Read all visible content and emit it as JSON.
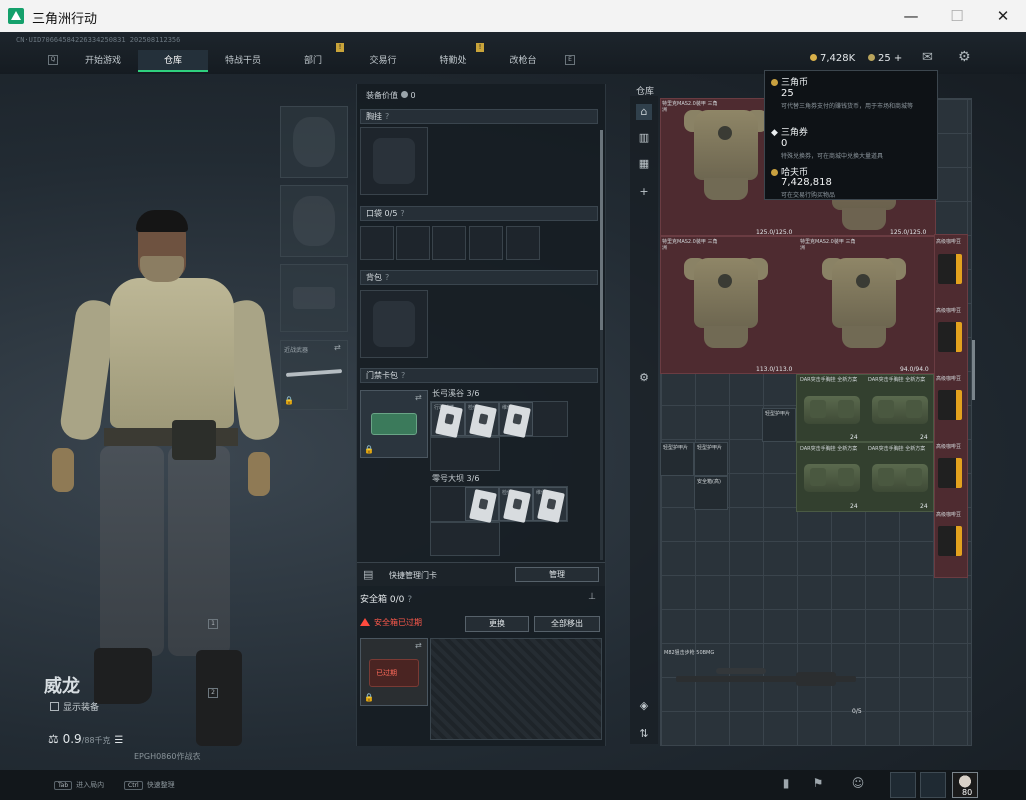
{
  "window": {
    "title": "三角洲行动",
    "minimize": "—",
    "maximize": "☐",
    "close": "✕"
  },
  "header": {
    "uid": "CN·UID70664584226334250831 202508112356",
    "key_left": "Q",
    "key_right": "E",
    "tabs": [
      {
        "label": "开始游戏",
        "active": false,
        "alert": false
      },
      {
        "label": "仓库",
        "active": true,
        "alert": false
      },
      {
        "label": "特战干员",
        "active": false,
        "alert": false
      },
      {
        "label": "部门",
        "active": false,
        "alert": true
      },
      {
        "label": "交易行",
        "active": false,
        "alert": false
      },
      {
        "label": "特勤处",
        "active": false,
        "alert": true
      },
      {
        "label": "改枪台",
        "active": false,
        "alert": false
      }
    ],
    "alert_mark": "!",
    "hafu_coin": "7,428K",
    "delta_coin": "25",
    "plus": "+"
  },
  "character": {
    "name": "威龙",
    "show_equipment": "显示装备",
    "weight": "0.9",
    "weight_max": "/88千克",
    "code": "EPGH0860作战衣",
    "side_key_1": "1",
    "side_key_2": "2"
  },
  "equip_slots": {
    "melee_label": "近战武器",
    "lock": "🔒"
  },
  "loadout": {
    "value_label": "装备价值",
    "value": "0",
    "chest_label": "胸挂",
    "pocket_label": "口袋",
    "pocket_count": "0/5",
    "backpack_label": "背包",
    "keycard_label": "门禁卡包",
    "q": "?",
    "long_row_label": "长弓溪谷",
    "long_row_count": "3/6",
    "zero_row_label": "零号大坝",
    "zero_row_count": "3/6",
    "card_tag_1": "行政辅楼",
    "card_tag_2": "检修",
    "card_tag_3": "维修",
    "quick_manage": "快捷管理门卡",
    "manage_btn": "管理",
    "safe_label": "安全箱",
    "safe_count": "0/0",
    "safe_warning": "安全箱已过期",
    "replace_btn": "更换",
    "move_all_btn": "全部移出",
    "expired_tag": "已过期"
  },
  "warehouse": {
    "label": "仓库",
    "side_icons": [
      "warehouse-icon",
      "list-icon",
      "grid-icon",
      "plus-icon",
      "gear-icon",
      "layers-icon",
      "sort-icon"
    ],
    "armor_name_1": "特里克MAS2.0装甲 三角洲",
    "armor_name_2": "特里克MAS2.0装甲 三角洲",
    "armor_name_3": "特里克MAS2.0装甲 三角洲",
    "dura_1": "125.0/125.0",
    "dura_2": "125.0/125.0",
    "dura_3": "113.0/113.0",
    "dura_4": "94.0/94.0",
    "bag_name": "高级咖啡豆",
    "pack_name": "DAR突击手胸挂 全新方案",
    "pack_count": "24",
    "small_name_1": "轻型护甲片",
    "small_name_2": "轻型护甲片",
    "small_name_3": "轻型护甲片",
    "small_name_4": "安全箱(高)",
    "rifle_name": "M82狙击步枪 50BMG",
    "rifle_count": "0/5"
  },
  "tooltip": {
    "delta_title": "三角币",
    "delta_value": "25",
    "delta_desc": "可代替三角券支付的赚钱货币，用于市场和商城等",
    "ticket_title": "三角券",
    "ticket_value": "0",
    "ticket_desc": "特殊兑换券，可在商城中兑换大量道具",
    "hafu_title": "哈夫币",
    "hafu_value": "7,428,818",
    "hafu_desc": "可在交易行购买物品"
  },
  "footer": {
    "hint1_key": "Tab",
    "hint1": "进入局内",
    "hint2_key": "Ctrl",
    "hint2": "快速整理",
    "level": "80"
  }
}
